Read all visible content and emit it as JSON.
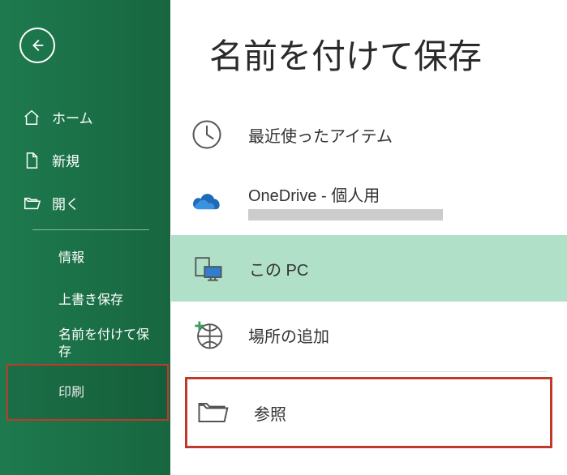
{
  "sidebar": {
    "home": "ホーム",
    "new": "新規",
    "open": "開く",
    "info": "情報",
    "save": "上書き保存",
    "saveas": "名前を付けて保存",
    "print": "印刷"
  },
  "main": {
    "title": "名前を付けて保存",
    "recent": "最近使ったアイテム",
    "onedrive": "OneDrive - 個人用",
    "thispc": "この PC",
    "addplace": "場所の追加",
    "browse": "参照"
  }
}
